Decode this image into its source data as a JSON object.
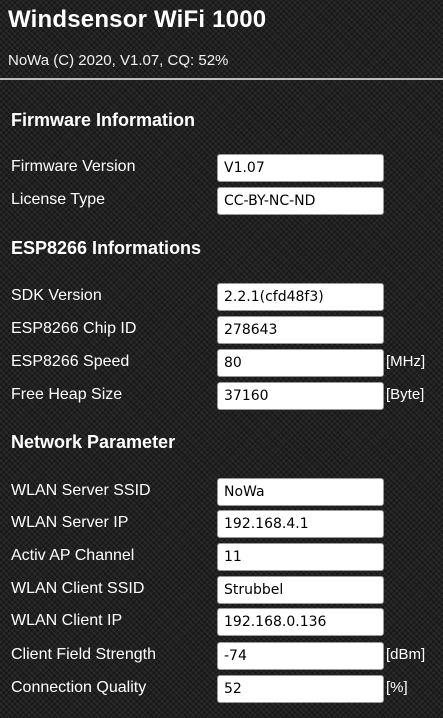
{
  "header": {
    "title": "Windsensor WiFi 1000",
    "subtitle": "NoWa (C) 2020, V1.07, CQ: 52%"
  },
  "sections": {
    "firmware": {
      "title": "Firmware Information",
      "rows": [
        {
          "label": "Firmware Version",
          "value": "V1.07",
          "unit": ""
        },
        {
          "label": "License Type",
          "value": "CC-BY-NC-ND",
          "unit": ""
        }
      ]
    },
    "esp": {
      "title": "ESP8266 Informations",
      "rows": [
        {
          "label": "SDK Version",
          "value": "2.2.1(cfd48f3)",
          "unit": ""
        },
        {
          "label": "ESP8266 Chip ID",
          "value": "278643",
          "unit": ""
        },
        {
          "label": "ESP8266 Speed",
          "value": "80",
          "unit": "[MHz]"
        },
        {
          "label": "Free Heap Size",
          "value": "37160",
          "unit": "[Byte]"
        }
      ]
    },
    "network": {
      "title": "Network Parameter",
      "rows": [
        {
          "label": "WLAN Server SSID",
          "value": "NoWa",
          "unit": ""
        },
        {
          "label": "WLAN Server IP",
          "value": "192.168.4.1",
          "unit": ""
        },
        {
          "label": "Activ AP Channel",
          "value": "11",
          "unit": ""
        },
        {
          "label": "WLAN Client SSID",
          "value": "Strubbel",
          "unit": ""
        },
        {
          "label": "WLAN Client IP",
          "value": "192.168.0.136",
          "unit": ""
        },
        {
          "label": "Client Field Strength",
          "value": "-74",
          "unit": "[dBm]"
        },
        {
          "label": "Connection Quality",
          "value": "52",
          "unit": "[%]"
        }
      ]
    }
  }
}
